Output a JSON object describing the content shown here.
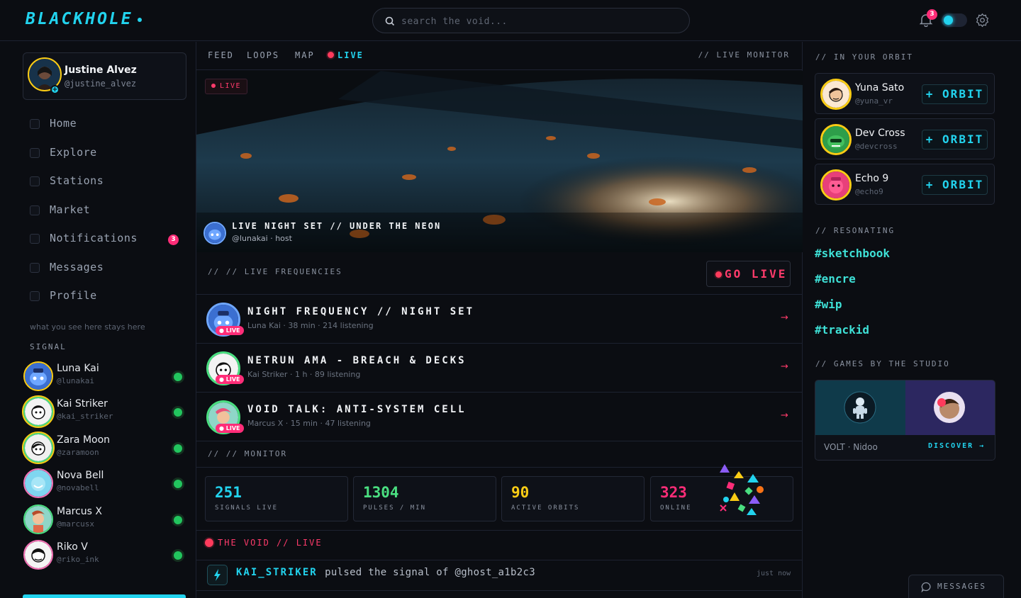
{
  "app": {
    "logo": "BLACKHOLE"
  },
  "search": {
    "placeholder": "search the void..."
  },
  "header": {
    "notifications_count": "3",
    "toggle_on": true
  },
  "profile": {
    "name": "Justine Alvez",
    "handle": "@justine_alvez"
  },
  "nav": {
    "items": [
      {
        "label": "Home"
      },
      {
        "label": "Explore"
      },
      {
        "label": "Stations"
      },
      {
        "label": "Market"
      },
      {
        "label": "Notifications",
        "badge": "3"
      },
      {
        "label": "Messages"
      },
      {
        "label": "Profile"
      }
    ]
  },
  "sidebar": {
    "tagline": "what you see here stays here",
    "signal_heading": "SIGNAL",
    "signal": [
      {
        "name": "Luna Kai",
        "handle": "@lunakai"
      },
      {
        "name": "Kai Striker",
        "handle": "@kai_striker"
      },
      {
        "name": "Zara Moon",
        "handle": "@zaramoon"
      },
      {
        "name": "Nova Bell",
        "handle": "@novabell"
      },
      {
        "name": "Marcus X",
        "handle": "@marcusx"
      },
      {
        "name": "Riko V",
        "handle": "@riko_ink"
      }
    ]
  },
  "tabs": [
    "FEED",
    "LOOPS",
    "MAP",
    "LIVE"
  ],
  "live_monitor_label": "// LIVE MONITOR",
  "hero": {
    "badge": "LIVE",
    "title": "LIVE NIGHT SET // UNDER THE NEON",
    "subtitle": "@lunakai · host"
  },
  "frequencies": {
    "heading": "// // LIVE FREQUENCIES",
    "go_live": "GO LIVE",
    "live_tag": "● LIVE",
    "items": [
      {
        "title": "NIGHT FREQUENCY // NIGHT SET",
        "meta": "Luna Kai · 38 min · 214 listening"
      },
      {
        "title": "NETRUN AMA - BREACH & DECKS",
        "meta": "Kai Striker · 1 h · 89 listening"
      },
      {
        "title": "VOID TALK: ANTI-SYSTEM CELL",
        "meta": "Marcus X · 15 min · 47 listening"
      }
    ]
  },
  "monitor": {
    "heading": "// // MONITOR",
    "stats": [
      {
        "value": "251",
        "label": "SIGNALS LIVE",
        "color": "#22d3ee"
      },
      {
        "value": "1304",
        "label": "PULSES / MIN",
        "color": "#4ade80"
      },
      {
        "value": "90",
        "label": "ACTIVE ORBITS",
        "color": "#facc15"
      },
      {
        "value": "323",
        "label": "ONLINE",
        "color": "#ff2d78"
      }
    ]
  },
  "void": {
    "heading": "THE VOID // LIVE",
    "pulse": {
      "user": "KAI_STRIKER",
      "text": "pulsed the signal of @ghost_a1b2c3",
      "time": "just now"
    }
  },
  "orbit": {
    "heading": "// IN YOUR ORBIT",
    "button": "+ ORBIT",
    "people": [
      {
        "name": "Yuna Sato",
        "handle": "@yuna_vr"
      },
      {
        "name": "Dev Cross",
        "handle": "@devcross"
      },
      {
        "name": "Echo 9",
        "handle": "@echo9"
      }
    ]
  },
  "resonating": {
    "heading": "// RESONATING",
    "tags": [
      "#sketchbook",
      "#encre",
      "#wip",
      "#trackid"
    ]
  },
  "games": {
    "heading": "// GAMES BY THE STUDIO",
    "caption": "VOLT · Nidoo",
    "discover": "DISCOVER →"
  },
  "messages_dock": {
    "label": "MESSAGES"
  }
}
